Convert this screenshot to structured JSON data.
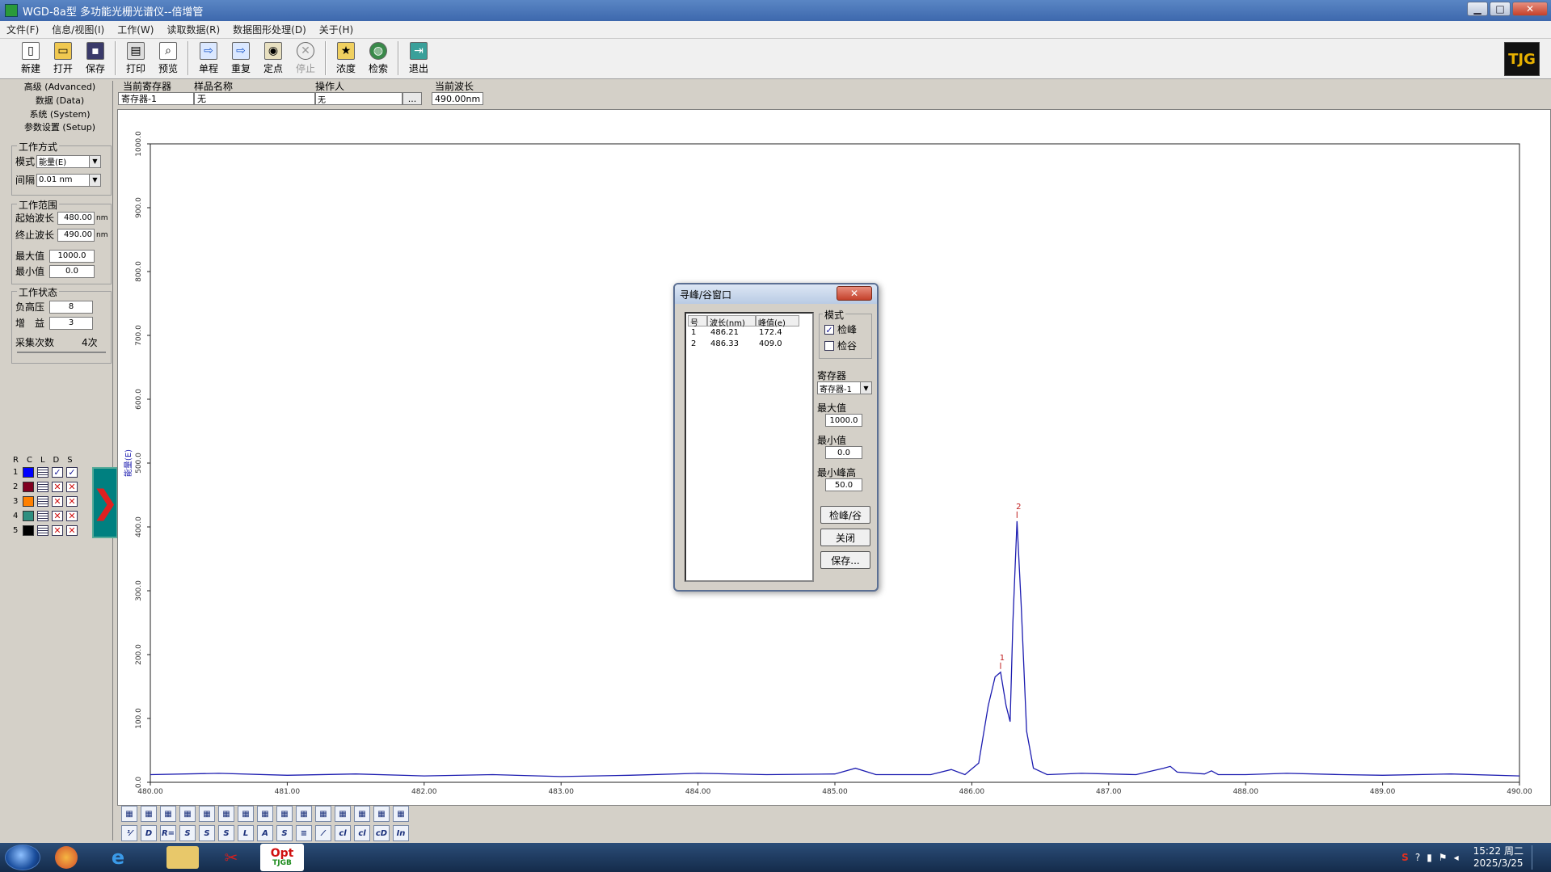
{
  "window": {
    "title": "WGD-8a型 多功能光栅光谱仪--倍增管",
    "minimize": "▁",
    "maximize": "□",
    "close": "✕"
  },
  "menu": [
    "文件(F)",
    "信息/视图(I)",
    "工作(W)",
    "读取数据(R)",
    "数据图形处理(D)",
    "关于(H)"
  ],
  "toolbar": {
    "new": "新建",
    "open": "打开",
    "save": "保存",
    "print": "打印",
    "preview": "预览",
    "single": "单程",
    "repeat": "重复",
    "fixed": "定点",
    "stop": "停止",
    "concentration": "浓度",
    "search": "检索",
    "exit": "退出",
    "logo": "TJG"
  },
  "left": {
    "tab_advanced": "高级 (Advanced)",
    "tab_data": "数据 (Data)",
    "tab_system": "系统 (System)",
    "tab_setup": "参数设置 (Setup)",
    "mode_group": "工作方式",
    "mode_label": "模式",
    "mode_value": "能量(E)",
    "interval_label": "间隔",
    "interval_value": "0.01 nm",
    "range_group": "工作范围",
    "start_label": "起始波长",
    "start_value": "480.00",
    "end_label": "终止波长",
    "end_value": "490.00",
    "unit_nm": "nm",
    "max_label": "最大值",
    "max_value": "1000.0",
    "min_label": "最小值",
    "min_value": "0.0",
    "status_group": "工作状态",
    "hv_label": "负高压",
    "hv_value": "8",
    "gain_label": "增　益",
    "gain_value": "3",
    "samples_label": "采集次数",
    "samples_value": "4次",
    "rcl_headers": [
      "R",
      "C",
      "L",
      "D",
      "S"
    ],
    "registers": [
      {
        "n": "1",
        "color": "#0000ff",
        "d": "✓",
        "s": "✓"
      },
      {
        "n": "2",
        "color": "#800020",
        "d": "✕",
        "s": "✕"
      },
      {
        "n": "3",
        "color": "#ff8000",
        "d": "✕",
        "s": "✕"
      },
      {
        "n": "4",
        "color": "#2f8f80",
        "d": "✕",
        "s": "✕"
      },
      {
        "n": "5",
        "color": "#000000",
        "d": "✕",
        "s": "✕"
      }
    ]
  },
  "reg": {
    "cur_reg_label": "当前寄存器",
    "cur_reg_value": "寄存器-1",
    "sample_label": "样品名称",
    "sample_value": "无",
    "operator_label": "操作人",
    "operator_value": "无",
    "more": "...",
    "cur_wl_label": "当前波长",
    "cur_wl_value": "490.00nm"
  },
  "chart_data": {
    "type": "line",
    "ylabel": "能量(E)",
    "xlim": [
      480,
      490
    ],
    "ylim": [
      0,
      1000
    ],
    "xticks": [
      "480.00",
      "481.00",
      "482.00",
      "483.00",
      "484.00",
      "485.00",
      "486.00",
      "487.00",
      "488.00",
      "489.00",
      "490.00"
    ],
    "yticks": [
      "0.0",
      "100.0",
      "200.0",
      "300.0",
      "400.0",
      "500.0",
      "600.0",
      "700.0",
      "800.0",
      "900.0",
      "1000.0"
    ],
    "line_color": "#1c1cb0",
    "series": [
      {
        "x": [
          480.0,
          480.5,
          481.0,
          481.5,
          482.0,
          482.5,
          483.0,
          483.5,
          484.0,
          484.5,
          485.0,
          485.15,
          485.3,
          485.7,
          485.85,
          485.95,
          486.05,
          486.12,
          486.17,
          486.21,
          486.25,
          486.28,
          486.3,
          486.33,
          486.36,
          486.4,
          486.45,
          486.55,
          486.8,
          487.2,
          487.4,
          487.45,
          487.5,
          487.7,
          487.75,
          487.8,
          488.0,
          488.3,
          488.7,
          489.0,
          489.5,
          490.0
        ],
        "y": [
          12,
          14,
          11,
          13,
          10,
          12,
          9,
          11,
          14,
          12,
          13,
          22,
          12,
          12,
          20,
          12,
          30,
          120,
          165,
          172.4,
          120,
          95,
          250,
          409,
          280,
          80,
          22,
          12,
          14,
          12,
          22,
          25,
          16,
          13,
          18,
          12,
          12,
          14,
          12,
          11,
          13,
          10
        ]
      }
    ],
    "peak_labels": [
      {
        "label": "1",
        "x": 486.21,
        "y": 172.4
      },
      {
        "label": "2",
        "x": 486.33,
        "y": 409.0
      }
    ]
  },
  "dialog": {
    "title": "寻峰/谷窗口",
    "close": "✕",
    "columns": [
      "号",
      "波长(nm)",
      "峰值(e)"
    ],
    "rows": [
      {
        "no": "1",
        "wl": "486.21",
        "peak": "172.4"
      },
      {
        "no": "2",
        "wl": "486.33",
        "peak": "409.0"
      }
    ],
    "mode_group": "模式",
    "peak_label": "检峰",
    "valley_label": "检谷",
    "reg_label": "寄存器",
    "reg_value": "寄存器-1",
    "max_label": "最大值",
    "max_value": "1000.0",
    "min_label": "最小值",
    "min_value": "0.0",
    "minpeak_label": "最小峰高",
    "minpeak_value": "50.0",
    "btn_detect": "检峰/谷",
    "btn_close": "关闭",
    "btn_save": "保存..."
  },
  "bottom_tools": {
    "row2": [
      "⅟",
      "D",
      "R=",
      "S",
      "S",
      "S",
      "L",
      "A",
      "S",
      "≡",
      "⁄",
      "cl",
      "cl",
      "cD",
      "In"
    ]
  },
  "taskbar": {
    "opt_label": "Opt",
    "opt_sub": "TJGB",
    "clock_time": "15:22 周二",
    "clock_date": "2025/3/25"
  }
}
